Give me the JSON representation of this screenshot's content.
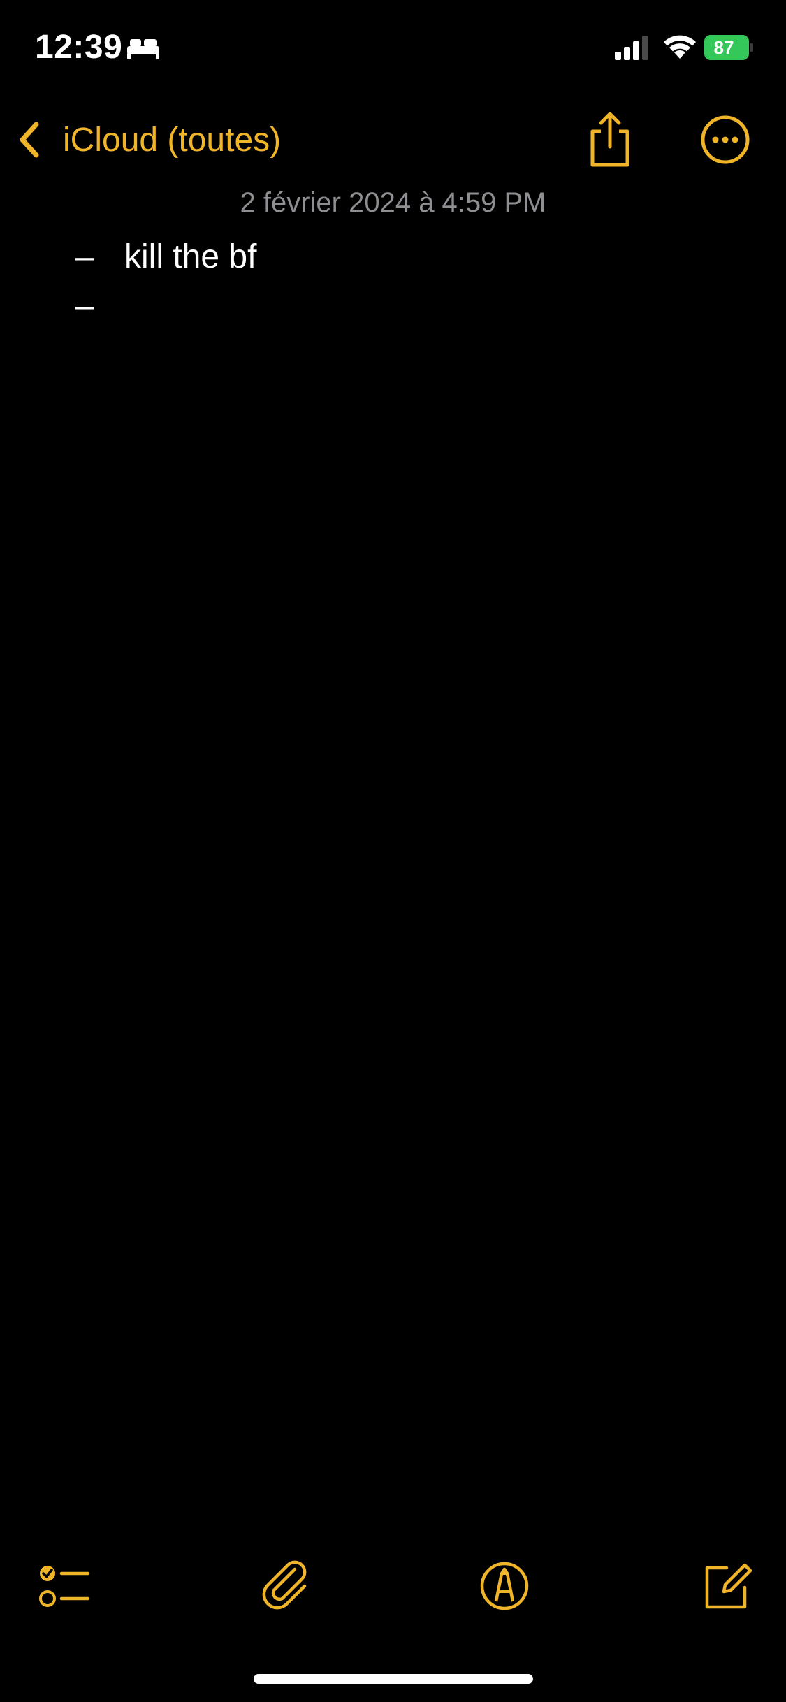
{
  "status_bar": {
    "time": "12:39",
    "sleep_icon": "bed-icon",
    "battery_level": "87",
    "battery_charging": true,
    "battery_color": "#34c759"
  },
  "nav": {
    "back_label": "iCloud (toutes)",
    "share_icon": "share-icon",
    "more_icon": "ellipsis-circle-icon",
    "accent_color": "#f0b429"
  },
  "note": {
    "date": "2 février 2024 à 4:59 PM",
    "lines": [
      {
        "bullet": "–",
        "text": "kill the bf"
      },
      {
        "bullet": "–",
        "text": ""
      }
    ]
  },
  "toolbar": {
    "items": [
      {
        "icon": "checklist-icon"
      },
      {
        "icon": "paperclip-icon"
      },
      {
        "icon": "markup-pen-icon"
      },
      {
        "icon": "compose-icon"
      }
    ]
  }
}
